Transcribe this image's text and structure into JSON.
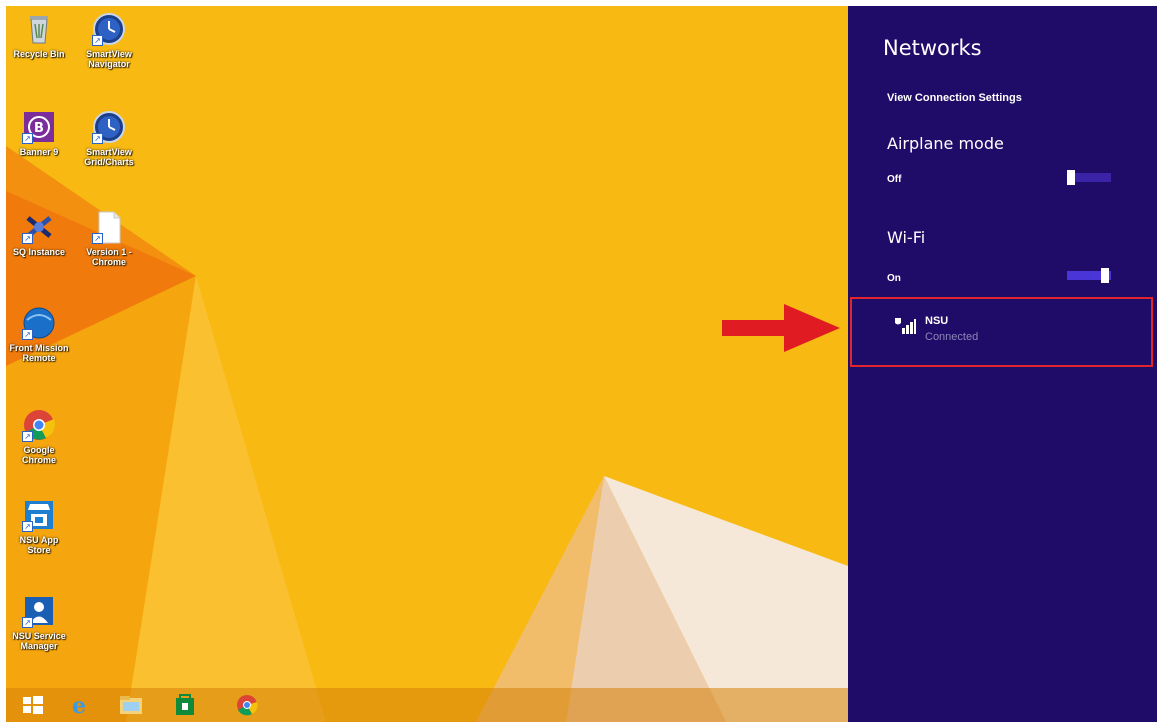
{
  "desktop": {
    "icons": [
      {
        "label": "Recycle Bin"
      },
      {
        "label": "SmartView Navigator"
      },
      {
        "label": "Banner 9"
      },
      {
        "label": "SmartView Grid/Charts"
      },
      {
        "label": "SQ Instance"
      },
      {
        "label": "Version 1 - Chrome"
      },
      {
        "label": "Front Mission Remote"
      },
      {
        "label": "Google Chrome"
      },
      {
        "label": "NSU App Store"
      },
      {
        "label": "NSU Service Manager"
      }
    ]
  },
  "taskbar": {
    "items": [
      "start-icon",
      "internet-explorer-icon",
      "file-explorer-icon",
      "store-icon",
      "chrome-icon"
    ]
  },
  "flyout": {
    "title": "Networks",
    "view_connection_settings": "View Connection Settings",
    "airplane_mode": {
      "label": "Airplane mode",
      "state": "Off",
      "on": false
    },
    "wifi": {
      "label": "Wi-Fi",
      "state": "On",
      "on": true
    },
    "network": {
      "name": "NSU",
      "status": "Connected"
    }
  },
  "colors": {
    "flyout_bg": "#1f0c68",
    "wallpaper": "#f7b70f",
    "highlight": "#e0252f"
  }
}
